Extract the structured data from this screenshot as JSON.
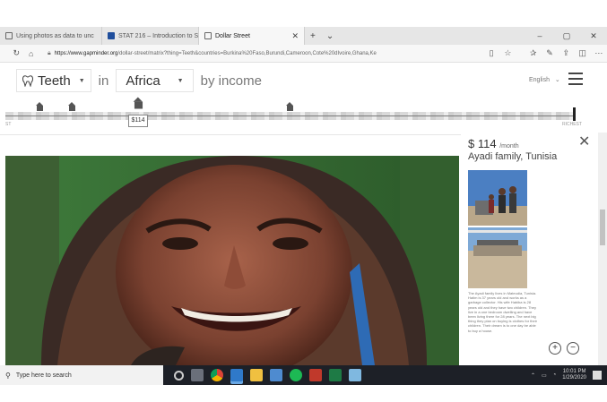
{
  "browser": {
    "tabs": [
      {
        "label": "Using photos as data to unc"
      },
      {
        "label": "STAT 216 – Introduction to S"
      },
      {
        "label": "Dollar Street"
      }
    ],
    "window_controls": {
      "minimize": "–",
      "maximize": "▢",
      "close": "✕"
    },
    "url_host": "https://www.gapminder.org",
    "url_path": "/dollar-street/matrix?thing=Teeth&countries=Burkina%20Faso,Burundi,Cameroon,Cote%20dIvoire,Ghana,Ke"
  },
  "header": {
    "thing": "Teeth",
    "word_in": "in",
    "region": "Africa",
    "word_by": "by income",
    "language": "English"
  },
  "street": {
    "price_tooltip": "$114",
    "label_left": "ST",
    "label_right": "RICHEST"
  },
  "panel": {
    "price": "$ 114",
    "per": "/month",
    "family": "Ayadi family, Tunisia",
    "description": "The Ayadi family lives in Mateudia, Tunisia. Hatim is 37 years old and works as a garbage collector. His wife Habiba is 28 years old and they have two children. They live in a one bedroom dwelling and have been living there for 28 years. The next big thing they plan on buying is clothes for their children. Their dream is to one day be able to buy a house.",
    "zoom_in": "+",
    "zoom_out": "−"
  },
  "taskbar": {
    "search_placeholder": "Type here to search",
    "time": "10:01 PM",
    "date": "1/29/2020"
  },
  "colors": {
    "taskbar_bg": "#1d2027",
    "tab_strip": "#e6e6e6",
    "accent_taskbar": "#69a7e4"
  }
}
